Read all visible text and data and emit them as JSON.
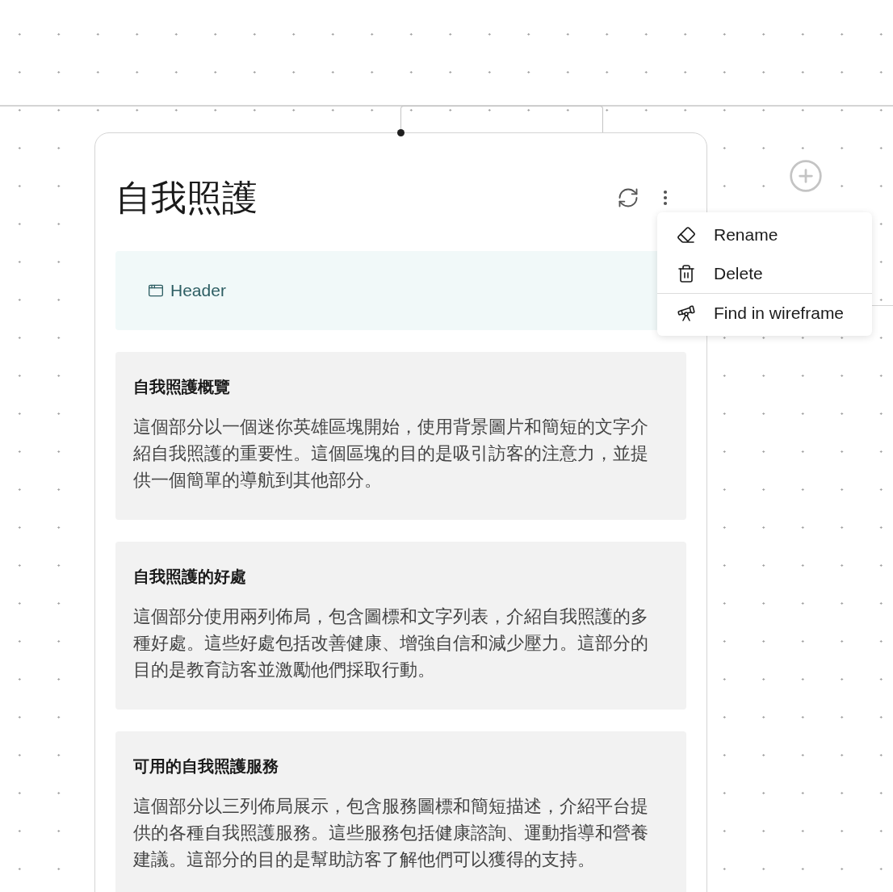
{
  "card": {
    "title": "自我照護",
    "header_block": {
      "label": "Header"
    },
    "sections": [
      {
        "title": "自我照護概覽",
        "description": "這個部分以一個迷你英雄區塊開始，使用背景圖片和簡短的文字介紹自我照護的重要性。這個區塊的目的是吸引訪客的注意力，並提供一個簡單的導航到其他部分。"
      },
      {
        "title": "自我照護的好處",
        "description": "這個部分使用兩列佈局，包含圖標和文字列表，介紹自我照護的多種好處。這些好處包括改善健康、增強自信和減少壓力。這部分的目的是教育訪客並激勵他們採取行動。"
      },
      {
        "title": "可用的自我照護服務",
        "description": "這個部分以三列佈局展示，包含服務圖標和簡短描述，介紹平台提供的各種自我照護服務。這些服務包括健康諮詢、運動指導和營養建議。這部分的目的是幫助訪客了解他們可以獲得的支持。"
      }
    ]
  },
  "context_menu": {
    "items": [
      {
        "kind": "rename",
        "label": "Rename"
      },
      {
        "kind": "delete",
        "label": "Delete"
      },
      {
        "kind": "find",
        "label": "Find in wireframe"
      }
    ]
  }
}
